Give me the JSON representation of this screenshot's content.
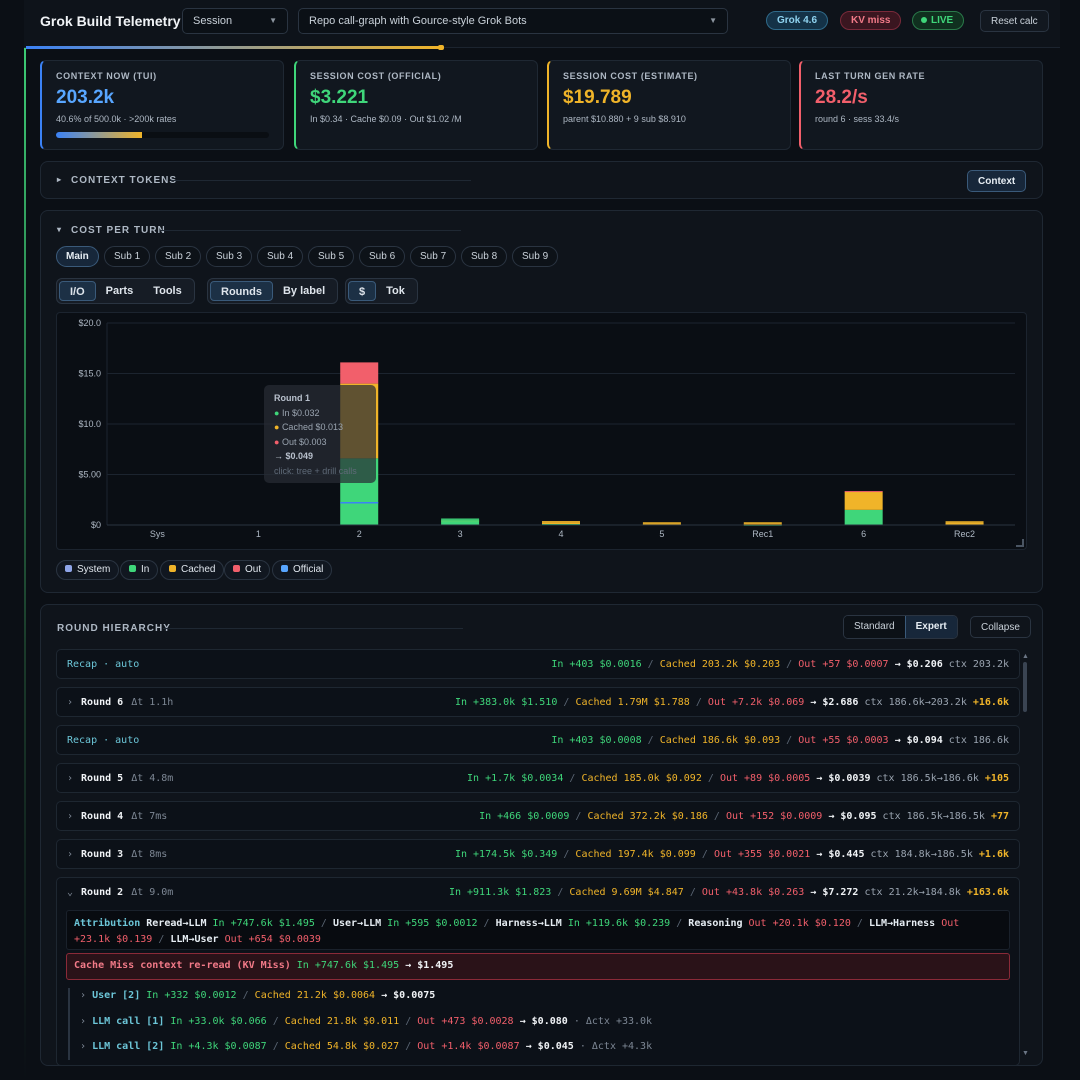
{
  "header": {
    "title": "Grok Build Telemetry",
    "session_select": "Session",
    "graph_select": "Repo call-graph with Gource-style Grok Bots",
    "model_badge": "Grok 4.6",
    "kv_badge": "KV miss",
    "live_badge": "LIVE",
    "reset_label": "Reset calc"
  },
  "colors": {
    "blue": "#3b82f6",
    "green": "#3fd67a",
    "yellow": "#f0b429",
    "red": "#f25f6b",
    "system": "#8fa5e8"
  },
  "cards": [
    {
      "label": "CONTEXT NOW (TUI)",
      "value": "203.2k",
      "sub": "40.6% of 500.0k · >200k rates",
      "progress": 0.406
    },
    {
      "label": "SESSION COST (OFFICIAL)",
      "value": "$3.221",
      "sub": "In $0.34 · Cache $0.09 · Out $1.02 /M"
    },
    {
      "label": "SESSION COST (ESTIMATE)",
      "value": "$19.789",
      "sub": "parent $10.880 + 9 sub $8.910"
    },
    {
      "label": "LAST TURN GEN RATE",
      "value": "28.2/s",
      "sub": "round 6 · sess 33.4/s"
    }
  ],
  "context_tokens": {
    "label": "CONTEXT TOKENS",
    "button": "Context"
  },
  "cost_per_turn": {
    "label": "COST PER TURN",
    "tabs": [
      "Main",
      "Sub 1",
      "Sub 2",
      "Sub 3",
      "Sub 4",
      "Sub 5",
      "Sub 6",
      "Sub 7",
      "Sub 8",
      "Sub 9"
    ],
    "view_group": [
      "I/O",
      "Parts",
      "Tools"
    ],
    "group_group": [
      "Rounds",
      "By label"
    ],
    "unit_group": [
      "$",
      "Tok"
    ],
    "legend": [
      "System",
      "In",
      "Cached",
      "Out",
      "Official"
    ],
    "tooltip": {
      "title": "Round 1",
      "in": "In $0.032",
      "cached": "Cached $0.013",
      "out": "Out $0.003",
      "total": "→ $0.049",
      "hint": "click: tree + drill calls"
    }
  },
  "chart_data": {
    "type": "bar",
    "stacked": true,
    "categories": [
      "Sys",
      "1",
      "2",
      "3",
      "4",
      "5",
      "Rec1",
      "6",
      "Rec2"
    ],
    "series": [
      {
        "name": "System",
        "values": [
          0,
          0,
          0,
          0,
          0,
          0,
          0,
          0,
          0
        ]
      },
      {
        "name": "In",
        "values": [
          0,
          0,
          6.6,
          0.35,
          0.12,
          0.05,
          0.02,
          1.5,
          0.05
        ]
      },
      {
        "name": "Cached",
        "values": [
          0,
          0,
          7.4,
          0.1,
          0.08,
          0.03,
          0.06,
          1.79,
          0.13
        ]
      },
      {
        "name": "Out",
        "values": [
          0,
          0,
          2.1,
          0,
          0,
          0,
          0,
          0.07,
          0
        ]
      },
      {
        "name": "Official",
        "values": [
          0,
          0,
          2.2,
          0,
          0,
          0,
          0,
          0,
          0
        ]
      }
    ],
    "yticks": [
      "$0",
      "$5.00",
      "$10.0",
      "$15.0",
      "$20.0"
    ],
    "ylim": [
      0,
      20
    ],
    "grid": true,
    "legend_position": "bottom-left"
  },
  "hierarchy": {
    "label": "ROUND HIERARCHY",
    "standard": "Standard",
    "expert": "Expert",
    "collapse": "Collapse",
    "rows": [
      {
        "name": "Recap · auto",
        "dt": "",
        "in": "In +403 $0.0016",
        "cached": "Cached 203.2k $0.203",
        "out": "Out +57 $0.0007",
        "total": "→ $0.206",
        "ctx": "ctx 203.2k",
        "delta": ""
      },
      {
        "name": "Round 6",
        "dt": "Δt 1.1h",
        "in": "In +383.0k $1.510",
        "cached": "Cached 1.79M $1.788",
        "out": "Out +7.2k $0.069",
        "total": "→ $2.686",
        "ctx": "ctx 186.6k→203.2k",
        "delta": "+16.6k"
      },
      {
        "name": "Recap · auto",
        "dt": "",
        "in": "In +403 $0.0008",
        "cached": "Cached 186.6k $0.093",
        "out": "Out +55 $0.0003",
        "total": "→ $0.094",
        "ctx": "ctx 186.6k",
        "delta": ""
      },
      {
        "name": "Round 5",
        "dt": "Δt 4.8m",
        "in": "In +1.7k $0.0034",
        "cached": "Cached 185.0k $0.092",
        "out": "Out +89 $0.0005",
        "total": "→ $0.0039",
        "ctx": "ctx 186.5k→186.6k",
        "delta": "+105"
      },
      {
        "name": "Round 4",
        "dt": "Δt 7ms",
        "in": "In +466 $0.0009",
        "cached": "Cached 372.2k $0.186",
        "out": "Out +152 $0.0009",
        "total": "→ $0.095",
        "ctx": "ctx 186.5k→186.5k",
        "delta": "+77"
      },
      {
        "name": "Round 3",
        "dt": "Δt 8ms",
        "in": "In +174.5k $0.349",
        "cached": "Cached 197.4k $0.099",
        "out": "Out +355 $0.0021",
        "total": "→ $0.445",
        "ctx": "ctx 184.8k→186.5k",
        "delta": "+1.6k"
      },
      {
        "name": "Round 2",
        "dt": "Δt 9.0m",
        "in": "In +911.3k $1.823",
        "cached": "Cached 9.69M $4.847",
        "out": "Out +43.8k $0.263",
        "total": "→ $7.272",
        "ctx": "ctx 21.2k→184.8k",
        "delta": "+163.6k"
      }
    ],
    "attribution": {
      "label": "Attribution",
      "p1": "Reread→LLM",
      "p1v": "In +747.6k $1.495",
      "p2": "User→LLM",
      "p2v": "In +595 $0.0012",
      "p3": "Harness→LLM",
      "p3v": "In +119.6k $0.239",
      "p4": "Reasoning",
      "p4v": "Out +20.1k $0.120",
      "p5": "LLM→Harness",
      "p5v": "Out",
      "p5v2": "+23.1k $0.139",
      "p6": "LLM→User",
      "p6v": "Out +654 $0.0039"
    },
    "cache_miss": {
      "label": "Cache Miss context re-read (KV Miss)",
      "in": "In +747.6k $1.495",
      "total": "→ $1.495"
    },
    "children": [
      {
        "name": "User [2]",
        "in": "In +332 $0.0012",
        "cached": "Cached 21.2k $0.0064",
        "out": "",
        "total": "→ $0.0075",
        "dctx": ""
      },
      {
        "name": "LLM call [1]",
        "in": "In +33.0k $0.066",
        "cached": "Cached 21.8k $0.011",
        "out": "Out +473 $0.0028",
        "total": "→ $0.080",
        "dctx": "· Δctx +33.0k"
      },
      {
        "name": "LLM call [2]",
        "in": "In +4.3k $0.0087",
        "cached": "Cached 54.8k $0.027",
        "out": "Out +1.4k $0.0087",
        "total": "→ $0.045",
        "dctx": "· Δctx +4.3k"
      }
    ]
  }
}
